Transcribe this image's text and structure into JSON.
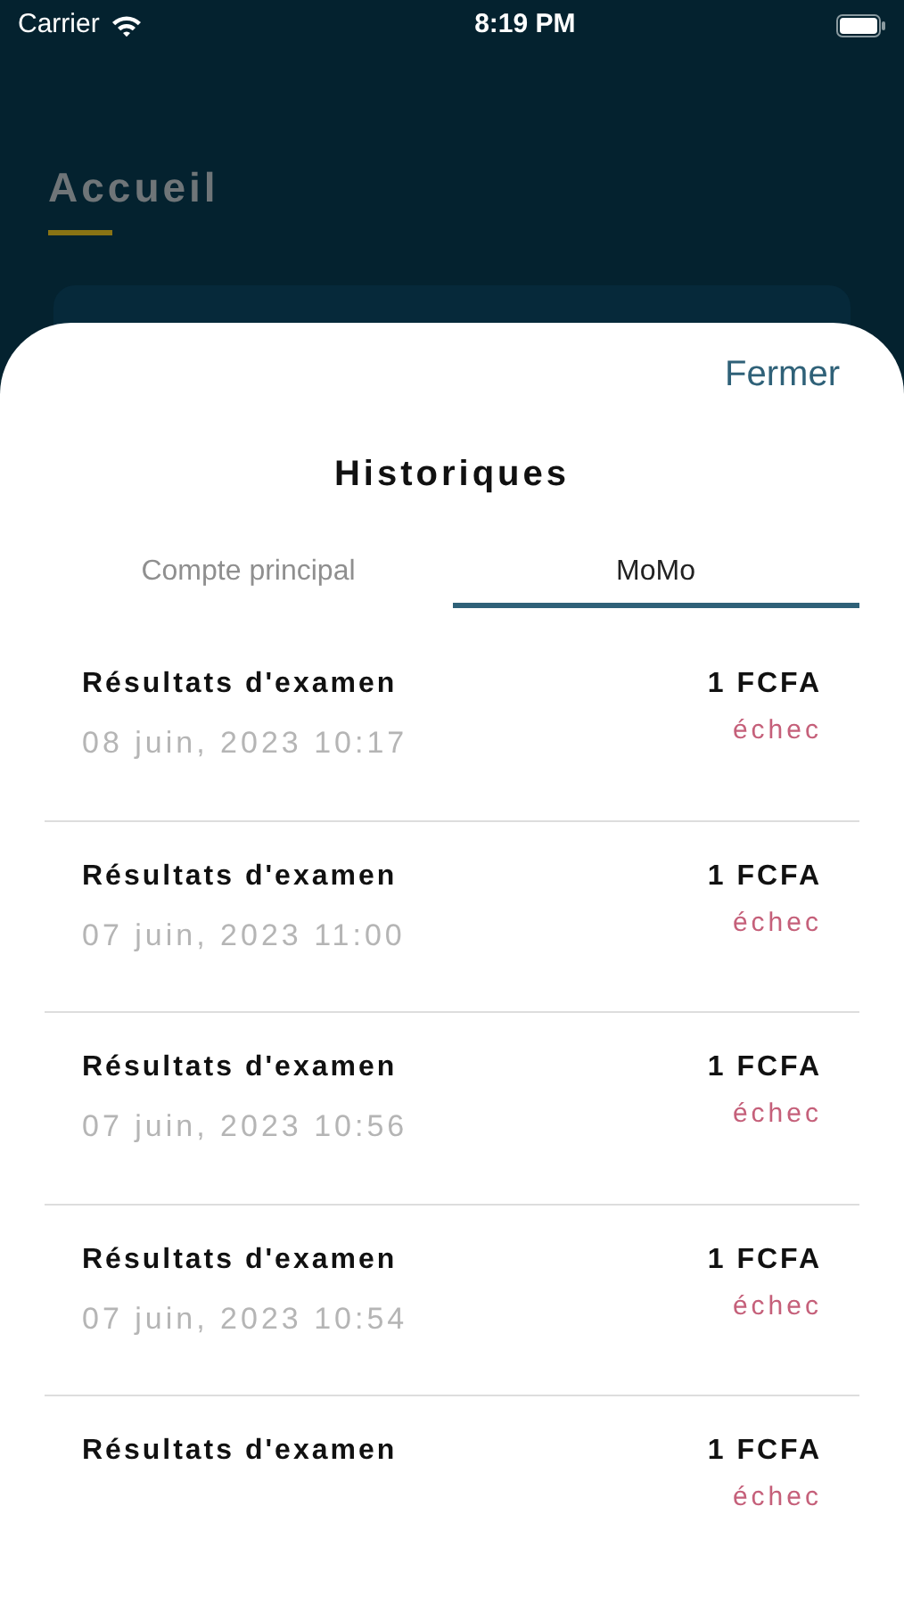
{
  "status_bar": {
    "carrier": "Carrier",
    "time": "8:19 PM"
  },
  "background": {
    "title": "Accueil"
  },
  "sheet": {
    "close": "Fermer",
    "title": "Historiques",
    "tabs": [
      {
        "label": "Compte principal",
        "selected": false
      },
      {
        "label": "MoMo",
        "selected": true
      }
    ],
    "transactions": [
      {
        "title": "Résultats d'examen",
        "date": "08 juin, 2023 10:17",
        "amount": "1 FCFA",
        "status": "échec"
      },
      {
        "title": "Résultats d'examen",
        "date": "07 juin, 2023 11:00",
        "amount": "1 FCFA",
        "status": "échec"
      },
      {
        "title": "Résultats d'examen",
        "date": "07 juin, 2023 10:56",
        "amount": "1 FCFA",
        "status": "échec"
      },
      {
        "title": "Résultats d'examen",
        "date": "07 juin, 2023 10:54",
        "amount": "1 FCFA",
        "status": "échec"
      },
      {
        "title": "Résultats d'examen",
        "amount": "1 FCFA",
        "status": "échec"
      }
    ]
  }
}
